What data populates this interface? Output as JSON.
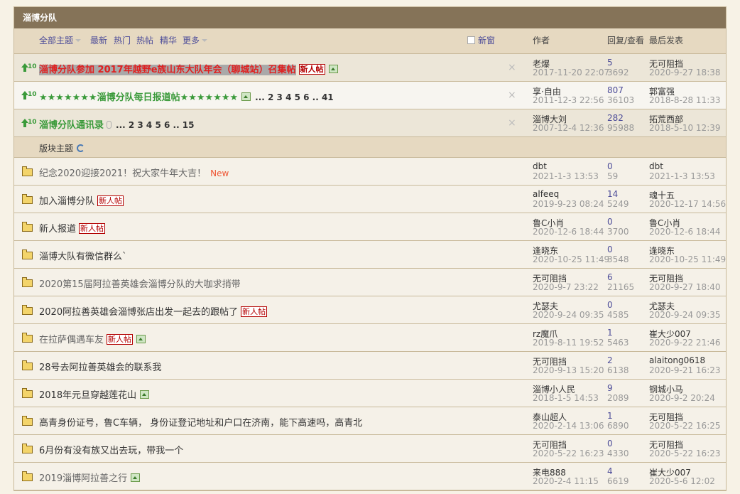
{
  "forum": {
    "title": "淄博分队"
  },
  "filters": {
    "all": "全部主题",
    "latest": "最新",
    "hot": "热门",
    "hot_posts": "热帖",
    "digest": "精华",
    "more": "更多",
    "new_window": "新窗"
  },
  "columns": {
    "author": "作者",
    "replies_views": "回复/查看",
    "last_post": "最后发表"
  },
  "sticky": [
    {
      "title": "淄博分队参加 2017年越野e族山东大队年会（聊城站）召集帖",
      "badge": "新人帖",
      "pages": "",
      "author": "老爆",
      "author_date": "2017-11-20 22:07",
      "replies": "5",
      "views": "3692",
      "last_user": "无可阻挡",
      "last_date": "2020-9-27 18:38"
    },
    {
      "title": "★★★★★★★淄博分队每日报道帖★★★★★★★",
      "badge": "",
      "pages": "... 2  3  4  5  6 .. 41",
      "author": "享·自由",
      "author_date": "2011-12-3 22:56",
      "replies": "807",
      "views": "36103",
      "last_user": "郭富强",
      "last_date": "2018-8-28 11:33"
    },
    {
      "title": "淄博分队通讯录",
      "badge": "",
      "pages": "... 2  3  4  5  6 .. 15",
      "author": "淄博大刘",
      "author_date": "2007-12-4 12:36",
      "replies": "282",
      "views": "95988",
      "last_user": "拓荒西部",
      "last_date": "2018-5-10 12:39"
    }
  ],
  "section_label": "版块主题",
  "close_glyph": "×",
  "pin_num": "10",
  "threads": [
    {
      "title": "纪念2020迎接2021！祝大家牛年大吉！",
      "tag": "New",
      "badge": "",
      "author": "dbt",
      "author_date": "2021-1-3 13:53",
      "replies": "0",
      "views": "59",
      "last_user": "dbt",
      "last_date": "2021-1-3 13:53"
    },
    {
      "title": "加入淄博分队",
      "tag": "",
      "badge": "新人帖",
      "author": "alfeeq",
      "author_date": "2019-9-23 08:24",
      "replies": "14",
      "views": "5249",
      "last_user": "魂十五",
      "last_date": "2020-12-17 14:56"
    },
    {
      "title": "新人报道",
      "tag": "",
      "badge": "新人帖",
      "author": "鲁C小肖",
      "author_date": "2020-12-6 18:44",
      "replies": "0",
      "views": "3700",
      "last_user": "鲁C小肖",
      "last_date": "2020-12-6 18:44"
    },
    {
      "title": "淄博大队有微信群么`",
      "tag": "",
      "badge": "",
      "author": "逢晓东",
      "author_date": "2020-10-25 11:49",
      "replies": "0",
      "views": "3548",
      "last_user": "逢晓东",
      "last_date": "2020-10-25 11:49"
    },
    {
      "title": "2020第15届阿拉善英雄会淄博分队的大咖求捎带",
      "tag": "",
      "badge": "",
      "author": "无可阻挡",
      "author_date": "2020-9-7 23:22",
      "replies": "6",
      "views": "21165",
      "last_user": "无可阻挡",
      "last_date": "2020-9-27 18:40"
    },
    {
      "title": "2020阿拉善英雄会淄博张店出发一起去的跟帖了",
      "tag": "",
      "badge": "新人帖",
      "author": "尤瑟夫",
      "author_date": "2020-9-24 09:35",
      "replies": "0",
      "views": "4585",
      "last_user": "尤瑟夫",
      "last_date": "2020-9-24 09:35"
    },
    {
      "title": "在拉萨偶遇车友",
      "tag": "",
      "badge": "新人帖",
      "author": "rz魔爪",
      "author_date": "2019-8-11 19:52",
      "replies": "1",
      "views": "5463",
      "last_user": "崔大少007",
      "last_date": "2020-9-22 21:46"
    },
    {
      "title": "28号去阿拉善英雄会的联系我",
      "tag": "",
      "badge": "",
      "author": "无可阻挡",
      "author_date": "2020-9-13 15:20",
      "replies": "2",
      "views": "6138",
      "last_user": "alaitong0618",
      "last_date": "2020-9-21 16:23"
    },
    {
      "title": "2018年元旦穿越莲花山",
      "tag": "",
      "badge": "",
      "author": "淄博小人民",
      "author_date": "2018-1-5 14:53",
      "replies": "9",
      "views": "2089",
      "last_user": "钢城小马",
      "last_date": "2020-9-2 20:24"
    },
    {
      "title": "高青身份证号，鲁C车辆， 身份证登记地址和户口在济南，能下高速吗，高青北",
      "tag": "",
      "badge": "",
      "author": "泰山超人",
      "author_date": "2020-2-14 13:06",
      "replies": "1",
      "views": "6890",
      "last_user": "无可阻挡",
      "last_date": "2020-5-22 16:25"
    },
    {
      "title": "6月份有没有族又出去玩，带我一个",
      "tag": "",
      "badge": "",
      "author": "无可阻挡",
      "author_date": "2020-5-22 16:23",
      "replies": "0",
      "views": "4330",
      "last_user": "无可阻挡",
      "last_date": "2020-5-22 16:23"
    },
    {
      "title": "2019淄博阿拉善之行",
      "tag": "",
      "badge": "",
      "author": "来电888",
      "author_date": "2020-2-4 11:15",
      "replies": "4",
      "views": "6619",
      "last_user": "崔大少007",
      "last_date": "2020-5-6 12:02"
    }
  ]
}
